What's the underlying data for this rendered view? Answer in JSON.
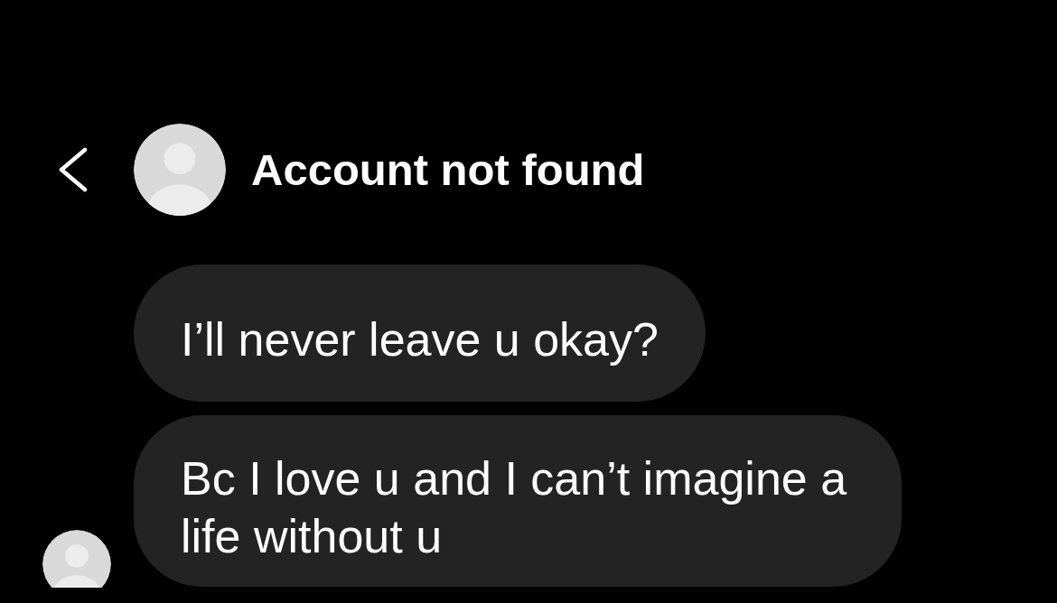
{
  "header": {
    "title": "Account not found"
  },
  "messages": [
    {
      "text": "I’ll never leave u okay?"
    },
    {
      "text": "Bc I love u and I can’t imagine a life without u"
    }
  ]
}
